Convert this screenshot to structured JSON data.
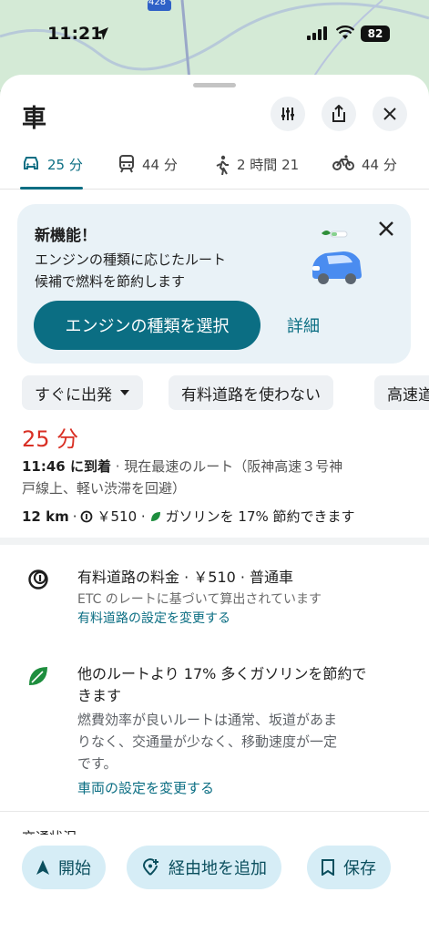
{
  "status_bar": {
    "time": "11:21",
    "battery": "82"
  },
  "map": {
    "road_badge": "428"
  },
  "header": {
    "title": "車"
  },
  "tabs": [
    {
      "mode": "car",
      "label": "25 分"
    },
    {
      "mode": "transit",
      "label": "44 分"
    },
    {
      "mode": "walk",
      "label": "2 時間 21"
    },
    {
      "mode": "bike",
      "label": "44 分"
    }
  ],
  "promo": {
    "heading": "新機能！",
    "body_line1": "エンジンの種類に応じたルート",
    "body_line2": "候補で燃料を節約します",
    "primary_button": "エンジンの種類を選択",
    "details_link": "詳細"
  },
  "chips": [
    "すぐに出発",
    "有料道路を使わない",
    "高速道"
  ],
  "route": {
    "duration": "25 分",
    "arrival_time": "11:46 に到着",
    "arrival_desc_1": " · 現在最速のルート（阪神高速３号神",
    "arrival_desc_2": "戸線上、軽い渋滞を回避）",
    "distance": "12 km",
    "toll": "￥510 ·",
    "fuel_saving": "ガソリンを 17% 節約できます"
  },
  "toll_info": {
    "title": "有料道路の料金 · ￥510 · 普通車",
    "subtitle": "ETC のレートに基づいて算出されています",
    "link": "有料道路の設定を変更する"
  },
  "fuel_info": {
    "title_line1": "他のルートより 17% 多くガソリンを節約で",
    "title_line2": "きます",
    "desc_line1": "燃費効率が良いルートは通常、坂道があま",
    "desc_line2": "りなく、交通量が少なく、移動速度が一定",
    "desc_line3": "です。",
    "link": "車両の設定を変更する"
  },
  "partial_section": "交通状況",
  "bottom_actions": {
    "start": "開始",
    "add_stop": "経由地を追加",
    "save": "保存"
  },
  "colors": {
    "accent": "#0b6e83",
    "duration": "#d93025",
    "chip_bg": "#eef1f4",
    "promo_bg": "#e9f2f7",
    "action_bg": "#d6edf6"
  }
}
